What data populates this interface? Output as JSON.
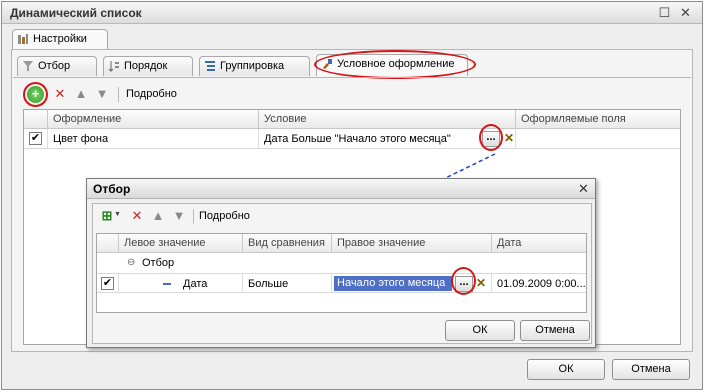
{
  "window": {
    "title": "Динамический список"
  },
  "settings_tab": {
    "label": "Настройки"
  },
  "tabs": [
    {
      "label": "Отбор"
    },
    {
      "label": "Порядок"
    },
    {
      "label": "Группировка"
    },
    {
      "label": "Условное оформление"
    }
  ],
  "toolbar": {
    "more_label": "Подробно"
  },
  "main_table": {
    "columns": [
      "Оформление",
      "Условие",
      "Оформляемые поля"
    ],
    "rows": [
      {
        "checked": true,
        "appearance": "Цвет фона",
        "condition": "Дата Больше \"Начало этого месяца\"",
        "fields": ""
      }
    ]
  },
  "dialog": {
    "title": "Отбор",
    "toolbar": {
      "more_label": "Подробно"
    },
    "columns": [
      "Левое значение",
      "Вид сравнения",
      "Правое значение",
      "Дата"
    ],
    "group": {
      "label": "Отбор"
    },
    "row": {
      "checked": true,
      "left": "Дата",
      "comparison": "Больше",
      "right": "Начало этого месяца",
      "date": "01.09.2009 0:00..."
    },
    "ok_label": "ОК",
    "cancel_label": "Отмена"
  },
  "footer": {
    "ok_label": "ОК",
    "cancel_label": "Отмена"
  },
  "colors": {
    "highlight": "#d21616",
    "selection": "#4f6fc6",
    "arrow": "#1f3fd0"
  }
}
